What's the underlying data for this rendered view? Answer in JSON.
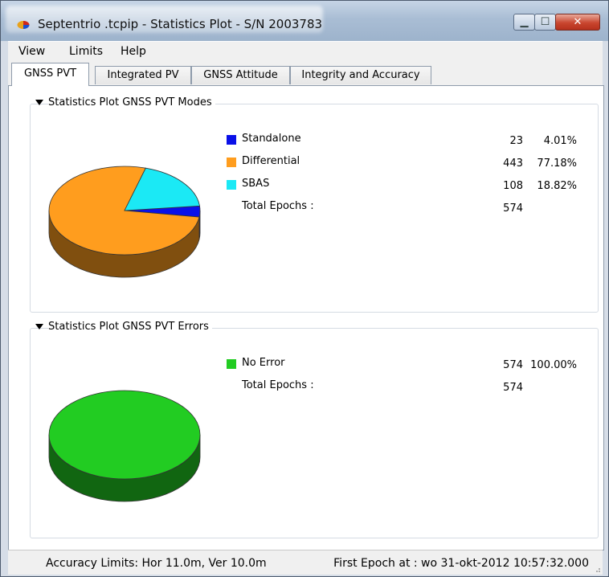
{
  "window": {
    "title": "Septentrio .tcpip - Statistics Plot - S/N 2003783",
    "icon": "septentrio-logo-icon",
    "controls": {
      "minimize": "minimize-icon",
      "maximize": "maximize-icon",
      "close": "close-icon"
    }
  },
  "menu": [
    {
      "label": "View"
    },
    {
      "label": "Limits"
    },
    {
      "label": "Help"
    }
  ],
  "tabs": [
    {
      "label": "GNSS PVT",
      "active": true
    },
    {
      "label": "Integrated PV",
      "active": false
    },
    {
      "label": "GNSS Attitude",
      "active": false
    },
    {
      "label": "Integrity and Accuracy",
      "active": false
    }
  ],
  "modes": {
    "title": "Statistics Plot GNSS PVT Modes",
    "items": [
      {
        "label": "Standalone",
        "count": "23",
        "percent": "4.01%",
        "color": "#0a10e8"
      },
      {
        "label": "Differential",
        "count": "443",
        "percent": "77.18%",
        "color": "#ff9d1e"
      },
      {
        "label": "SBAS",
        "count": "108",
        "percent": "18.82%",
        "color": "#1be9f5"
      }
    ],
    "total_label": "Total Epochs :",
    "total_value": "574"
  },
  "errors": {
    "title": "Statistics Plot GNSS PVT Errors",
    "items": [
      {
        "label": "No Error",
        "count": "574",
        "percent": "100.00%",
        "color": "#22cc22"
      }
    ],
    "total_label": "Total Epochs :",
    "total_value": "574"
  },
  "chart_data": [
    {
      "type": "pie",
      "title": "Statistics Plot GNSS PVT Modes",
      "categories": [
        "Standalone",
        "Differential",
        "SBAS"
      ],
      "values": [
        23,
        443,
        108
      ],
      "colors": [
        "#0a10e8",
        "#ff9d1e",
        "#1be9f5"
      ]
    },
    {
      "type": "pie",
      "title": "Statistics Plot GNSS PVT Errors",
      "categories": [
        "No Error"
      ],
      "values": [
        574
      ],
      "colors": [
        "#22cc22"
      ]
    }
  ],
  "status": {
    "accuracy": "Accuracy Limits: Hor 11.0m, Ver 10.0m",
    "first_epoch": "First Epoch at : wo 31-okt-2012 10:57:32.000"
  }
}
